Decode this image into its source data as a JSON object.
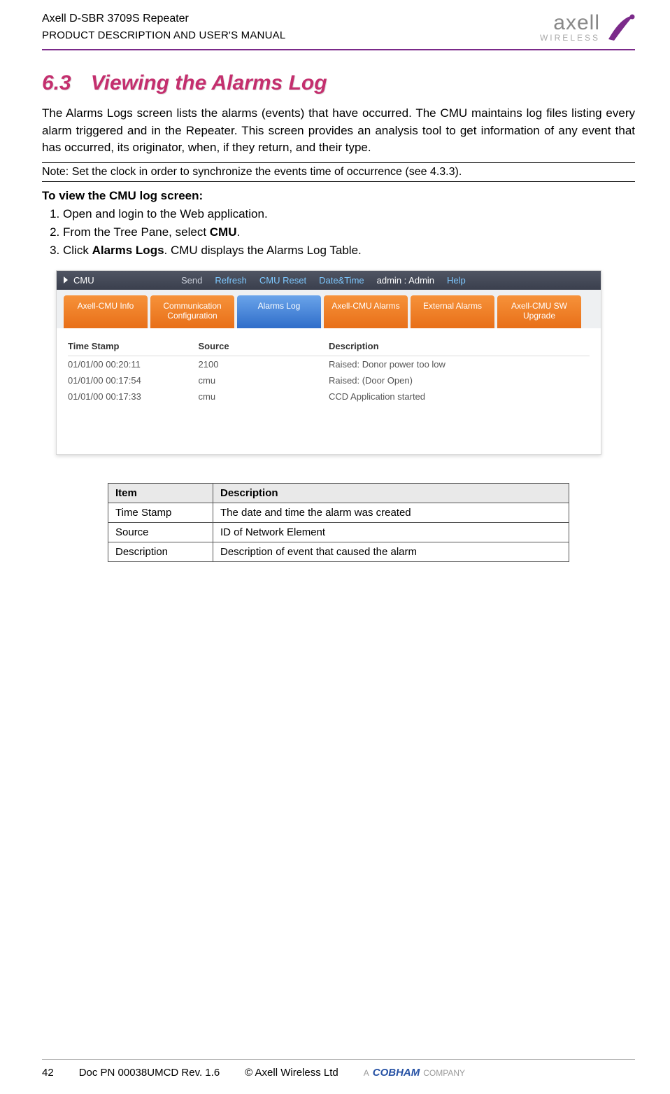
{
  "header": {
    "product": "Axell D-SBR 3709S Repeater",
    "doc_type": "PRODUCT DESCRIPTION AND USER'S MANUAL",
    "logo_main": "axell",
    "logo_sub": "WIRELESS"
  },
  "section": {
    "number": "6.3",
    "title": "Viewing the Alarms Log",
    "intro": "The Alarms Logs screen lists the alarms (events) that have occurred. The CMU maintains log files listing every alarm triggered and in the Repeater. This screen provides an analysis tool to get information of any event that has occurred, its originator, when, if they return, and their type.",
    "note": "Note: Set the clock in order to synchronize the events time of occurrence (see 4.3.3).",
    "instruction_title": "To view the CMU log screen:",
    "steps": {
      "s1": "Open and login to the Web application.",
      "s2_pre": "From the Tree Pane, select ",
      "s2_bold": "CMU",
      "s2_post": ".",
      "s3_pre": "Click ",
      "s3_bold": "Alarms Logs",
      "s3_post": ". CMU displays the Alarms Log Table."
    }
  },
  "screenshot": {
    "topbar": {
      "title": "CMU",
      "send": "Send",
      "refresh": "Refresh",
      "reset": "CMU Reset",
      "datetime": "Date&Time",
      "admin": "admin : Admin",
      "help": "Help"
    },
    "tabs": {
      "t1": "Axell-CMU Info",
      "t2": "Communication Configuration",
      "t3": "Alarms Log",
      "t4": "Axell-CMU Alarms",
      "t5": "External Alarms",
      "t6": "Axell-CMU SW Upgrade"
    },
    "columns": {
      "c1": "Time Stamp",
      "c2": "Source",
      "c3": "Description"
    },
    "rows": [
      {
        "ts": "01/01/00 00:20:11",
        "src": "2100",
        "desc": "Raised: Donor power too low"
      },
      {
        "ts": "01/01/00 00:17:54",
        "src": "cmu",
        "desc": "Raised: (Door Open)"
      },
      {
        "ts": "01/01/00 00:17:33",
        "src": "cmu",
        "desc": "CCD Application started"
      }
    ]
  },
  "legend": {
    "h1": "Item",
    "h2": "Description",
    "rows": [
      {
        "item": "Time Stamp",
        "desc": "The date and time the alarm was created"
      },
      {
        "item": "Source",
        "desc": "ID of Network Element"
      },
      {
        "item": "Description",
        "desc": "Description of event that caused the alarm"
      }
    ]
  },
  "footer": {
    "page": "42",
    "docref": "Doc PN 00038UMCD Rev. 1.6",
    "copyright": "© Axell Wireless Ltd",
    "company_prefix": "A",
    "company_logo": "COBHAM",
    "company_suffix": "COMPANY"
  }
}
